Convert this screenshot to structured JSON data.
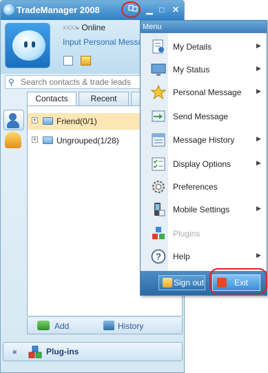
{
  "window": {
    "title": "TradeManager 2008",
    "minimize_label": "▁",
    "maximize_label": "□",
    "close_label": "✕",
    "menu_button_icon": "menu-icon"
  },
  "profile": {
    "user_name": "xxxx",
    "status": "- Online",
    "personal_message": "Input Personal Message"
  },
  "search": {
    "placeholder": "Search contacts & trade leads"
  },
  "tabs": [
    {
      "label": "Contacts",
      "active": true
    },
    {
      "label": "Recent",
      "active": false
    },
    {
      "label": "",
      "active": false
    }
  ],
  "groups": [
    {
      "label": "Friend(0/1)",
      "expander": "+",
      "selected": true
    },
    {
      "label": "Ungrouped(1/28)",
      "expander": "+",
      "selected": false
    }
  ],
  "bottom": {
    "add_label": "Add",
    "history_label": "History"
  },
  "plugins_bar": {
    "chevron": "«",
    "label": "Plug-ins"
  },
  "menu": {
    "header": "Menu",
    "items": [
      {
        "label": "My Details",
        "icon": "details-icon",
        "arrow": "▶",
        "enabled": true
      },
      {
        "label": "My Status",
        "icon": "monitor-icon",
        "arrow": "▶",
        "enabled": true
      },
      {
        "label": "Personal Message",
        "icon": "star-icon",
        "arrow": "▶",
        "enabled": true
      },
      {
        "label": "Send Message",
        "icon": "send-message-icon",
        "arrow": "",
        "enabled": true
      },
      {
        "label": "Message History",
        "icon": "message-history-icon",
        "arrow": "▶",
        "enabled": true
      },
      {
        "label": "Display Options",
        "icon": "display-options-icon",
        "arrow": "▶",
        "enabled": true
      },
      {
        "label": "Preferences",
        "icon": "gear-icon",
        "arrow": "",
        "enabled": true
      },
      {
        "label": "Mobile Settings",
        "icon": "mobile-icon",
        "arrow": "▶",
        "enabled": true
      },
      {
        "label": "Plugins",
        "icon": "plugins-icon",
        "arrow": "",
        "enabled": false
      },
      {
        "label": "Help",
        "icon": "help-icon",
        "arrow": "▶",
        "enabled": true
      }
    ],
    "sign_out_label": "Sign out",
    "exit_label": "Exit"
  },
  "colors": {
    "accent": "#2f80c4",
    "annotation_red": "#dd2222",
    "selected_row": "#fde7b5"
  }
}
